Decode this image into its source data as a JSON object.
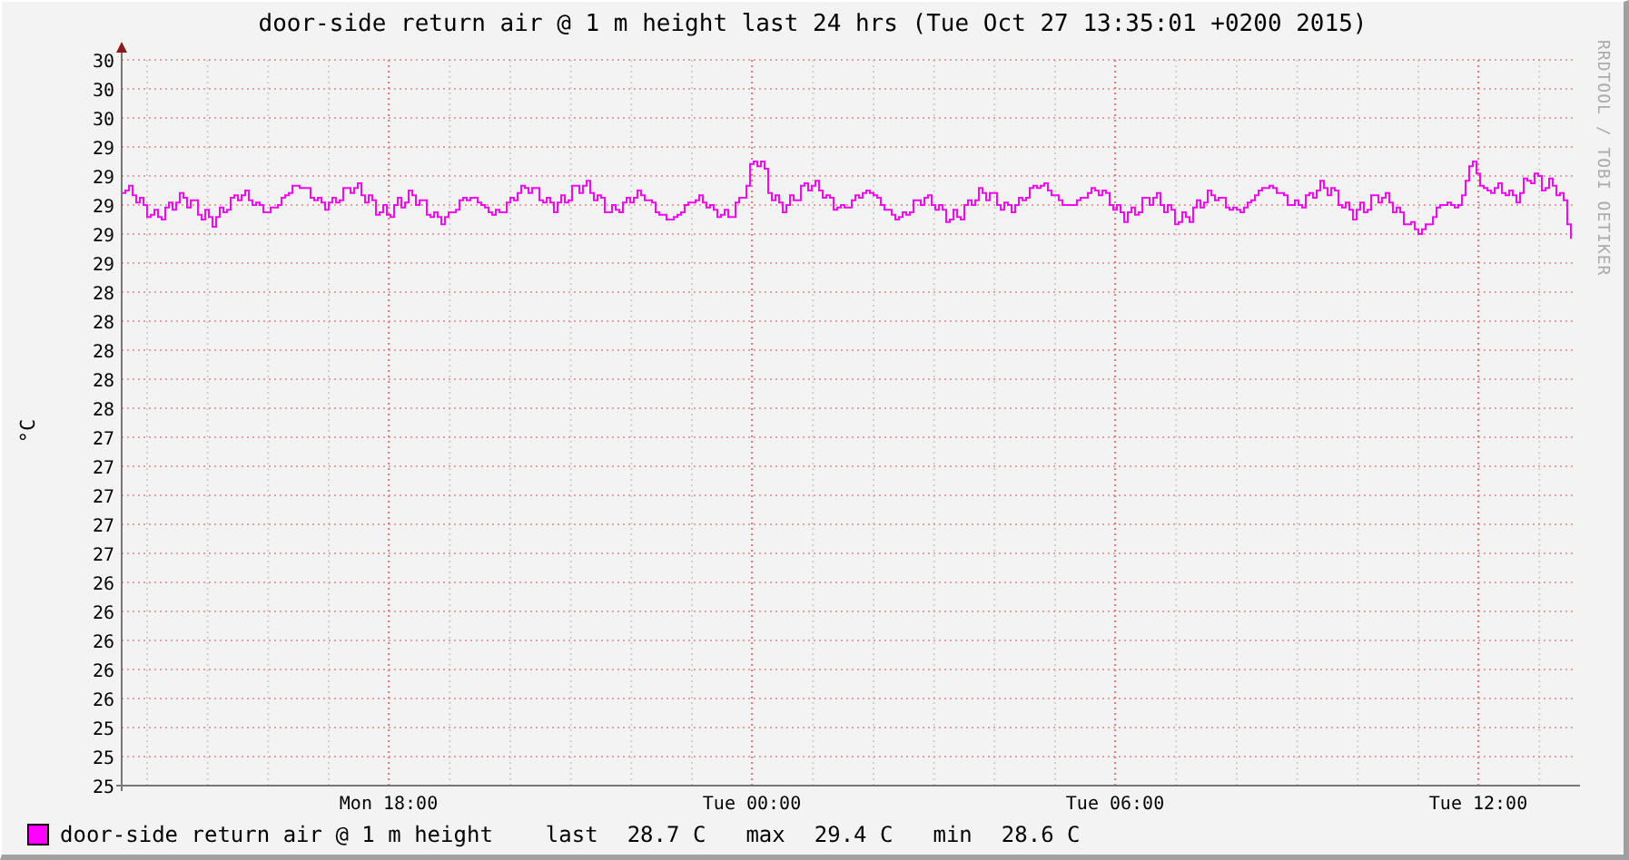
{
  "title": "door-side return air @ 1 m height last 24 hrs (Tue Oct 27 13:35:01 +0200 2015)",
  "y_axis": {
    "unit": "°C",
    "tick_labels": [
      "30",
      "30",
      "30",
      "29",
      "29",
      "29",
      "29",
      "29",
      "28",
      "28",
      "28",
      "28",
      "28",
      "27",
      "27",
      "27",
      "27",
      "27",
      "26",
      "26",
      "26",
      "26",
      "26",
      "25",
      "25",
      "25"
    ]
  },
  "x_axis": {
    "tick_labels": [
      "Mon 18:00",
      "Tue 00:00",
      "Tue 06:00",
      "Tue 12:00"
    ]
  },
  "credit": "RRDTOOL / TOBI OETIKER",
  "legend": {
    "name": "door-side return air @ 1 m height",
    "color": "#ff00ff",
    "stats": [
      {
        "label": "last",
        "value": "28.7 C"
      },
      {
        "label": "max",
        "value": "29.4 C"
      },
      {
        "label": "min",
        "value": "28.6 C"
      }
    ]
  }
}
